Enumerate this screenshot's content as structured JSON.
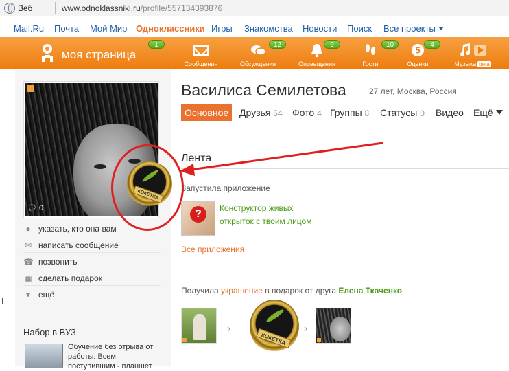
{
  "browser": {
    "tab_label": "Веб",
    "url_host": "www.odnoklassniki.ru",
    "url_path": "/profile/557134393876"
  },
  "portal_nav": [
    {
      "label": "Mail.Ru",
      "active": false
    },
    {
      "label": "Почта",
      "active": false
    },
    {
      "label": "Мой Мир",
      "active": false
    },
    {
      "label": "Одноклассники",
      "active": true
    },
    {
      "label": "Игры",
      "active": false
    },
    {
      "label": "Знакомства",
      "active": false
    },
    {
      "label": "Новости",
      "active": false
    },
    {
      "label": "Поиск",
      "active": false
    },
    {
      "label": "Все проекты",
      "active": false
    }
  ],
  "toolbar": {
    "my_page": "моя страница",
    "my_page_badge": "1",
    "items": [
      {
        "label": "Сообщения",
        "icon": "envelope-icon",
        "badge": ""
      },
      {
        "label": "Обсуждения",
        "icon": "chat-bubbles-icon",
        "badge": "12"
      },
      {
        "label": "Оповещения",
        "icon": "bell-icon",
        "badge": "9"
      },
      {
        "label": "Гости",
        "icon": "footprints-icon",
        "badge": "10"
      },
      {
        "label": "Оценки",
        "icon": "rating-five-icon",
        "badge": "4"
      },
      {
        "label": "Музыка",
        "icon": "music-note-icon",
        "badge": "",
        "extra": "beta"
      }
    ]
  },
  "profile": {
    "name": "Василиса Семилетова",
    "meta": "27 лет, Москва, Россия",
    "avatar_comments": "0",
    "decoration_ribbon": "КОКЕТКА",
    "tabs": [
      {
        "label": "Основное",
        "count": "",
        "active": true
      },
      {
        "label": "Друзья",
        "count": "54",
        "active": false
      },
      {
        "label": "Фото",
        "count": "4",
        "active": false
      },
      {
        "label": "Группы",
        "count": "8",
        "active": false
      },
      {
        "label": "Статусы",
        "count": "0",
        "active": false
      },
      {
        "label": "Видео",
        "count": "",
        "active": false
      },
      {
        "label": "Ещё",
        "count": "",
        "active": false
      }
    ]
  },
  "actions": [
    {
      "label": "указать, кто она вам",
      "icon": "pin-icon"
    },
    {
      "label": "написать сообщение",
      "icon": "envelope-icon"
    },
    {
      "label": "позвонить",
      "icon": "phone-icon"
    },
    {
      "label": "сделать подарок",
      "icon": "gift-icon"
    },
    {
      "label": "ещё",
      "icon": "triangle-down-icon"
    }
  ],
  "vuz": {
    "title": "Набор в ВУЗ",
    "text": "Обучение без отрыва от работы. Всем поступившим - планшет"
  },
  "feed": {
    "title": "Лента",
    "launched": "Запустила приложение",
    "app_name": "Конструктор живых открыток с твоим лицом",
    "all_apps": "Все приложения",
    "gift_prefix": "Получила",
    "gift_item": "украшение",
    "gift_middle": "в подарок от друга",
    "gift_from": "Елена Ткаченко"
  },
  "colors": {
    "brand_orange": "#eb722e",
    "toolbar_orange": "#f38a1c",
    "link_blue": "#1f5fa8",
    "link_green": "#4b9a18",
    "badge_green": "#5aa91d",
    "annotation_red": "#e02020"
  }
}
